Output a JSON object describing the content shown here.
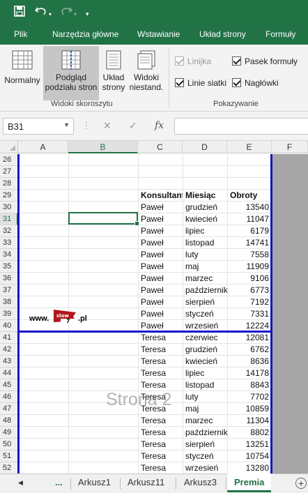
{
  "qat": {
    "save_icon": "save-icon",
    "undo_icon": "undo-icon",
    "redo_icon": "redo-icon",
    "customize_icon": "customize-qat-icon"
  },
  "ribbon_tabs": [
    "Plik",
    "Narzędzia główne",
    "Wstawianie",
    "Układ strony",
    "Formuły"
  ],
  "views_group": {
    "label": "Widoki skoroszytu",
    "normal": "Normalny",
    "pagebreak_1": "Podgląd",
    "pagebreak_2": "podziału stron",
    "layout_1": "Układ",
    "layout_2": "strony",
    "custom_1": "Widoki",
    "custom_2": "niestand."
  },
  "show_group": {
    "label": "Pokazywanie",
    "ruler": "Linijka",
    "formula_bar": "Pasek formuły",
    "gridlines": "Linie siatki",
    "headings": "Nagłówki"
  },
  "formula_bar": {
    "name_box": "B31",
    "fx": "fx",
    "cancel": "✕",
    "enter": "✓",
    "value": ""
  },
  "columns": [
    "A",
    "B",
    "C",
    "D",
    "E",
    "F"
  ],
  "rows": [
    "26",
    "27",
    "28",
    "29",
    "30",
    "31",
    "32",
    "33",
    "34",
    "35",
    "36",
    "37",
    "38",
    "39",
    "40",
    "41",
    "42",
    "43",
    "44",
    "45",
    "46",
    "47",
    "48",
    "49",
    "50",
    "51",
    "52"
  ],
  "logo": {
    "prefix": "www.",
    "flag": "slow",
    "digit": "7",
    "suffix": ".pl"
  },
  "table": {
    "headers": [
      "Konsultant",
      "Miesiąc",
      "Obroty"
    ],
    "rows": [
      [
        "Paweł",
        "grudzień",
        "13540"
      ],
      [
        "Paweł",
        "kwiecień",
        "11047"
      ],
      [
        "Paweł",
        "lipiec",
        "6179"
      ],
      [
        "Paweł",
        "listopad",
        "14741"
      ],
      [
        "Paweł",
        "luty",
        "7558"
      ],
      [
        "Paweł",
        "maj",
        "11909"
      ],
      [
        "Paweł",
        "marzec",
        "9106"
      ],
      [
        "Paweł",
        "październik",
        "6773"
      ],
      [
        "Paweł",
        "sierpień",
        "7192"
      ],
      [
        "Paweł",
        "styczeń",
        "7331"
      ],
      [
        "Paweł",
        "wrzesień",
        "12224"
      ],
      [
        "Teresa",
        "czerwiec",
        "12081"
      ],
      [
        "Teresa",
        "grudzień",
        "6762"
      ],
      [
        "Teresa",
        "kwiecień",
        "8636"
      ],
      [
        "Teresa",
        "lipiec",
        "14178"
      ],
      [
        "Teresa",
        "listopad",
        "8843"
      ],
      [
        "Teresa",
        "luty",
        "7702"
      ],
      [
        "Teresa",
        "maj",
        "10859"
      ],
      [
        "Teresa",
        "marzec",
        "11304"
      ],
      [
        "Teresa",
        "październik",
        "8802"
      ],
      [
        "Teresa",
        "sierpień",
        "13251"
      ],
      [
        "Teresa",
        "styczeń",
        "10754"
      ],
      [
        "Teresa",
        "wrzesień",
        "13280"
      ]
    ]
  },
  "page_watermark": "Strona 2",
  "sheet_tabs": {
    "nav_prev": "◀",
    "ellipsis": "...",
    "tabs": [
      "Arkusz1",
      "Arkusz11",
      "Arkusz3",
      "Premia"
    ],
    "active": "Premia",
    "add": "+"
  }
}
